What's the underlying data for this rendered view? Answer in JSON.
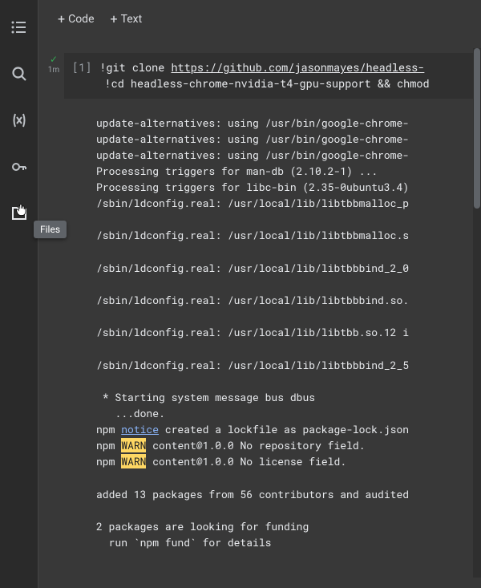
{
  "sidebar": {
    "tooltip": "Files"
  },
  "toolbar": {
    "code_label": "Code",
    "text_label": "Text"
  },
  "cell": {
    "exec_count": "[1]",
    "timing": "1m",
    "line1_prefix": "!",
    "line1_cmd": "git clone ",
    "line1_url": "https://github.com/jasonmayes/headless-",
    "line2": "!cd headless-chrome-nvidia-t4-gpu-support && chmod"
  },
  "output": {
    "l1": "update-alternatives: using /usr/bin/google-chrome-",
    "l2": "update-alternatives: using /usr/bin/google-chrome-",
    "l3": "update-alternatives: using /usr/bin/google-chrome-",
    "l4": "Processing triggers for man-db (2.10.2-1) ...",
    "l5": "Processing triggers for libc-bin (2.35-0ubuntu3.4)",
    "l6": "/sbin/ldconfig.real: /usr/local/lib/libtbbmalloc_p",
    "l7": "",
    "l8": "/sbin/ldconfig.real: /usr/local/lib/libtbbmalloc.s",
    "l9": "",
    "l10": "/sbin/ldconfig.real: /usr/local/lib/libtbbbind_2_0",
    "l11": "",
    "l12": "/sbin/ldconfig.real: /usr/local/lib/libtbbbind.so.",
    "l13": "",
    "l14": "/sbin/ldconfig.real: /usr/local/lib/libtbb.so.12 i",
    "l15": "",
    "l16": "/sbin/ldconfig.real: /usr/local/lib/libtbbbind_2_5",
    "l17": "",
    "l18": " * Starting system message bus dbus",
    "l19": "   ...done.",
    "npm_prefix": "npm ",
    "notice_word": "notice",
    "warn_word": "WARN",
    "npm_notice_rest": " created a lockfile as package-lock.json",
    "npm_warn1_rest": " content@1.0.0 No repository field.",
    "npm_warn2_rest": " content@1.0.0 No license field.",
    "l23": "",
    "l24": "added 13 packages from 56 contributors and audited",
    "l25": "",
    "l26": "2 packages are looking for funding",
    "l27": "  run `npm fund` for details"
  }
}
